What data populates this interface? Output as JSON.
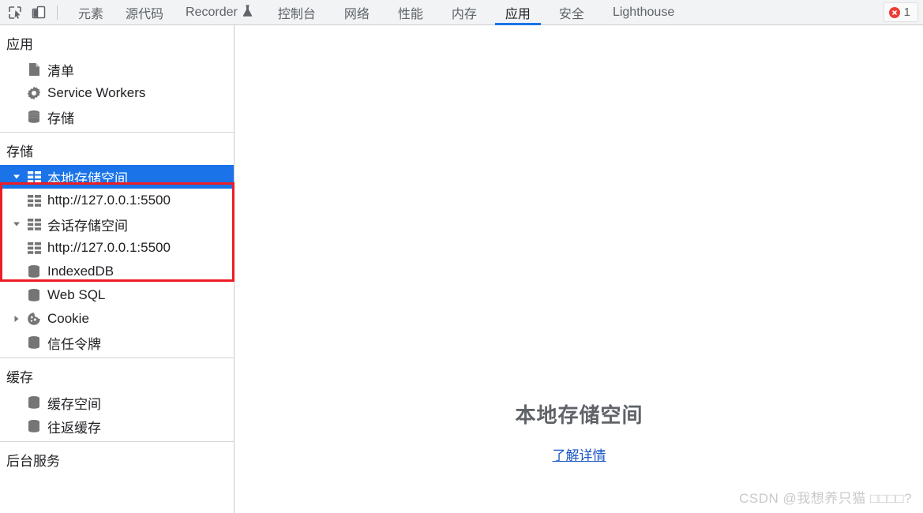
{
  "toolbar": {
    "icons": [
      {
        "name": "inspect-element-icon",
        "title": "检查元素"
      },
      {
        "name": "device-toolbar-icon",
        "title": "切换设备工具栏"
      }
    ],
    "tabs": [
      {
        "label": "元素",
        "active": false,
        "icon": null
      },
      {
        "label": "源代码",
        "active": false,
        "icon": null
      },
      {
        "label": "Recorder",
        "active": false,
        "icon": "flask-icon"
      },
      {
        "label": "控制台",
        "active": false,
        "icon": null
      },
      {
        "label": "网络",
        "active": false,
        "icon": null
      },
      {
        "label": "性能",
        "active": false,
        "icon": null
      },
      {
        "label": "内存",
        "active": false,
        "icon": null
      },
      {
        "label": "应用",
        "active": true,
        "icon": null
      },
      {
        "label": "安全",
        "active": false,
        "icon": null
      },
      {
        "label": "Lighthouse",
        "active": false,
        "icon": null
      }
    ],
    "error_badge": {
      "count": "1",
      "icon": "error-circle-icon"
    },
    "accent_color": "#1a73e8",
    "error_color": "#ee3b33"
  },
  "sidebar": {
    "sections": [
      {
        "title": "应用",
        "items": [
          {
            "label": "清单",
            "icon": "document-icon",
            "indent": 1,
            "twisty": "none",
            "selected": false
          },
          {
            "label": "Service Workers",
            "icon": "gear-icon",
            "indent": 1,
            "twisty": "none",
            "selected": false
          },
          {
            "label": "存储",
            "icon": "database-icon",
            "indent": 1,
            "twisty": "none",
            "selected": false
          }
        ]
      },
      {
        "title": "存储",
        "items": [
          {
            "label": "本地存储空间",
            "icon": "table-icon",
            "indent": 1,
            "twisty": "expanded",
            "selected": true
          },
          {
            "label": "http://127.0.0.1:5500",
            "icon": "table-icon",
            "indent": 2,
            "twisty": "none",
            "selected": false
          },
          {
            "label": "会话存储空间",
            "icon": "table-icon",
            "indent": 1,
            "twisty": "expanded",
            "selected": false
          },
          {
            "label": "http://127.0.0.1:5500",
            "icon": "table-icon",
            "indent": 2,
            "twisty": "none",
            "selected": false
          },
          {
            "label": "IndexedDB",
            "icon": "database-icon",
            "indent": 1,
            "twisty": "none",
            "selected": false
          },
          {
            "label": "Web SQL",
            "icon": "database-icon",
            "indent": 1,
            "twisty": "none",
            "selected": false
          },
          {
            "label": "Cookie",
            "icon": "cookie-icon",
            "indent": 1,
            "twisty": "collapsed",
            "selected": false
          },
          {
            "label": "信任令牌",
            "icon": "database-icon",
            "indent": 1,
            "twisty": "none",
            "selected": false
          }
        ]
      },
      {
        "title": "缓存",
        "items": [
          {
            "label": "缓存空间",
            "icon": "database-icon",
            "indent": 1,
            "twisty": "none",
            "selected": false
          },
          {
            "label": "往返缓存",
            "icon": "database-icon",
            "indent": 1,
            "twisty": "none",
            "selected": false
          }
        ]
      },
      {
        "title": "后台服务",
        "items": []
      }
    ],
    "selected_color": "#1a73e8"
  },
  "main": {
    "empty_title": "本地存储空间",
    "learn_more_label": "了解详情"
  },
  "watermark": {
    "text": "CSDN @我想养只猫 □□□□?"
  },
  "annotation": {
    "color": "#ee1c25",
    "target": "storage-tree-local-and-session"
  }
}
